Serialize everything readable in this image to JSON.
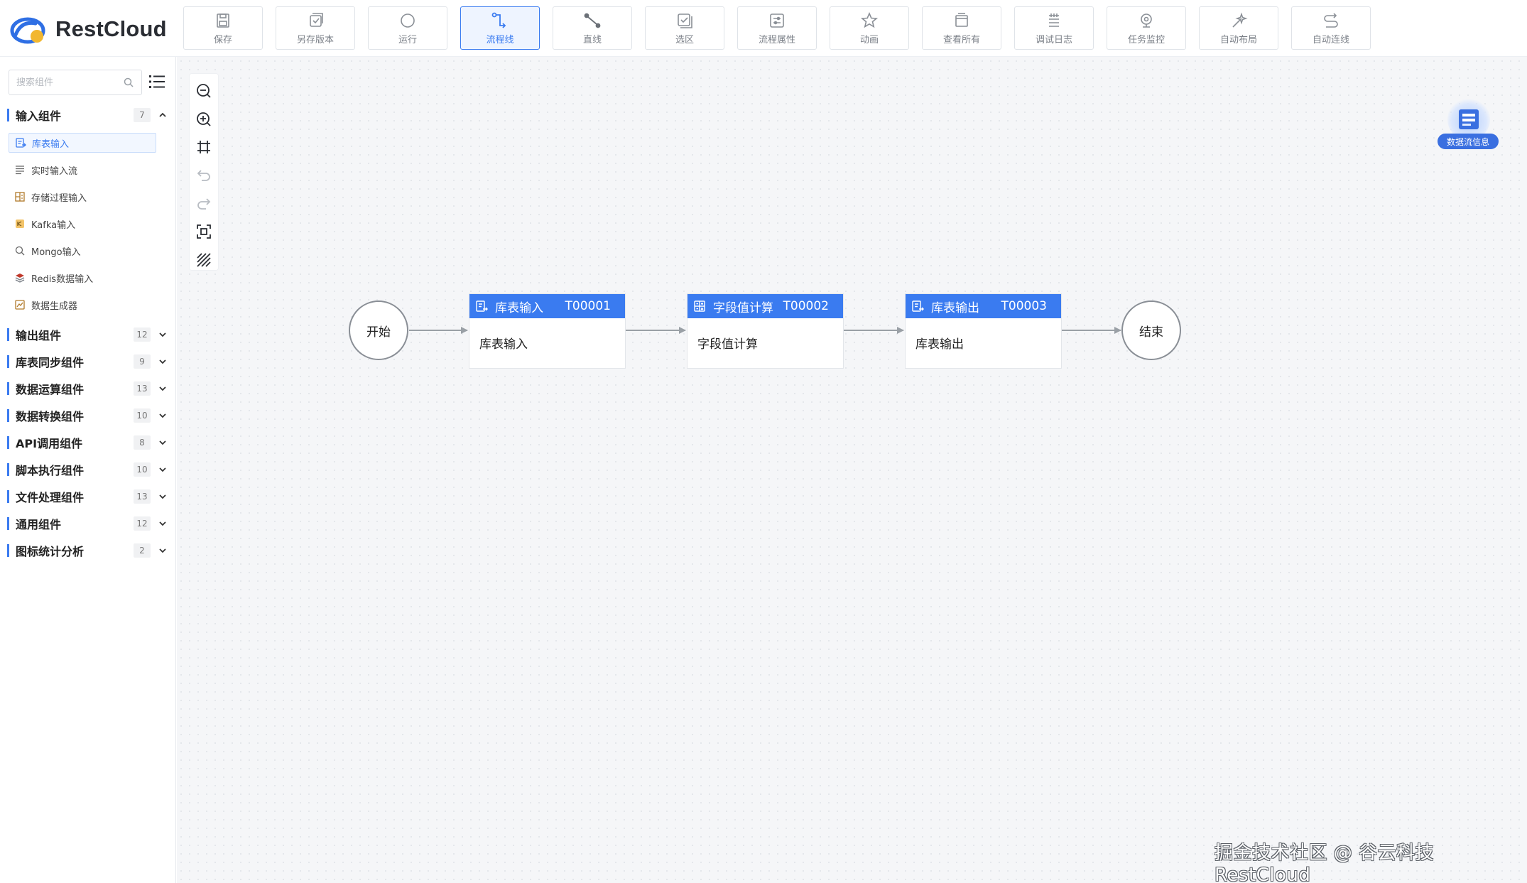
{
  "app": {
    "logo_text": "RestCloud"
  },
  "toolbar": {
    "buttons": [
      {
        "label": "保存",
        "icon": "save-icon"
      },
      {
        "label": "另存版本",
        "icon": "save-version-icon"
      },
      {
        "label": "运行",
        "icon": "run-icon"
      },
      {
        "label": "流程线",
        "icon": "flow-line-icon",
        "active": true
      },
      {
        "label": "直线",
        "icon": "straight-line-icon"
      },
      {
        "label": "选区",
        "icon": "selection-icon"
      },
      {
        "label": "流程属性",
        "icon": "flow-properties-icon"
      },
      {
        "label": "动画",
        "icon": "animation-icon"
      },
      {
        "label": "查看所有",
        "icon": "view-all-icon"
      },
      {
        "label": "调试日志",
        "icon": "debug-log-icon"
      },
      {
        "label": "任务监控",
        "icon": "task-monitor-icon"
      },
      {
        "label": "自动布局",
        "icon": "auto-layout-icon"
      },
      {
        "label": "自动连线",
        "icon": "auto-connect-icon"
      }
    ]
  },
  "sidebar": {
    "search_placeholder": "搜索组件",
    "groups": [
      {
        "name": "输入组件",
        "count": "7",
        "expanded": true
      },
      {
        "name": "输出组件",
        "count": "12"
      },
      {
        "name": "库表同步组件",
        "count": "9"
      },
      {
        "name": "数据运算组件",
        "count": "13"
      },
      {
        "name": "数据转换组件",
        "count": "10"
      },
      {
        "name": "API调用组件",
        "count": "8"
      },
      {
        "name": "脚本执行组件",
        "count": "10"
      },
      {
        "name": "文件处理组件",
        "count": "13"
      },
      {
        "name": "通用组件",
        "count": "12"
      },
      {
        "name": "图标统计分析",
        "count": "2"
      }
    ],
    "input_items": [
      {
        "name": "库表输入",
        "icon": "table-input-icon",
        "selected": true
      },
      {
        "name": "实时输入流",
        "icon": "realtime-stream-icon"
      },
      {
        "name": "存储过程输入",
        "icon": "stored-procedure-icon"
      },
      {
        "name": "Kafka输入",
        "icon": "kafka-icon"
      },
      {
        "name": "Mongo输入",
        "icon": "mongo-icon"
      },
      {
        "name": "Redis数据输入",
        "icon": "redis-icon"
      },
      {
        "name": "数据生成器",
        "icon": "data-generator-icon"
      }
    ]
  },
  "canvas": {
    "start_label": "开始",
    "end_label": "结束",
    "tasks": [
      {
        "title": "库表输入",
        "id": "T00001",
        "body": "库表输入"
      },
      {
        "title": "字段值计算",
        "id": "T00002",
        "body": "字段值计算"
      },
      {
        "title": "库表输出",
        "id": "T00003",
        "body": "库表输出"
      }
    ],
    "data_flow_info_label": "数据流信息"
  },
  "watermark": "掘金技术社区 @ 谷云科技RestCloud",
  "colors": {
    "accent": "#3a7bf0",
    "canvas_bg": "#f5f6f8",
    "node_border": "#8a8f96"
  }
}
